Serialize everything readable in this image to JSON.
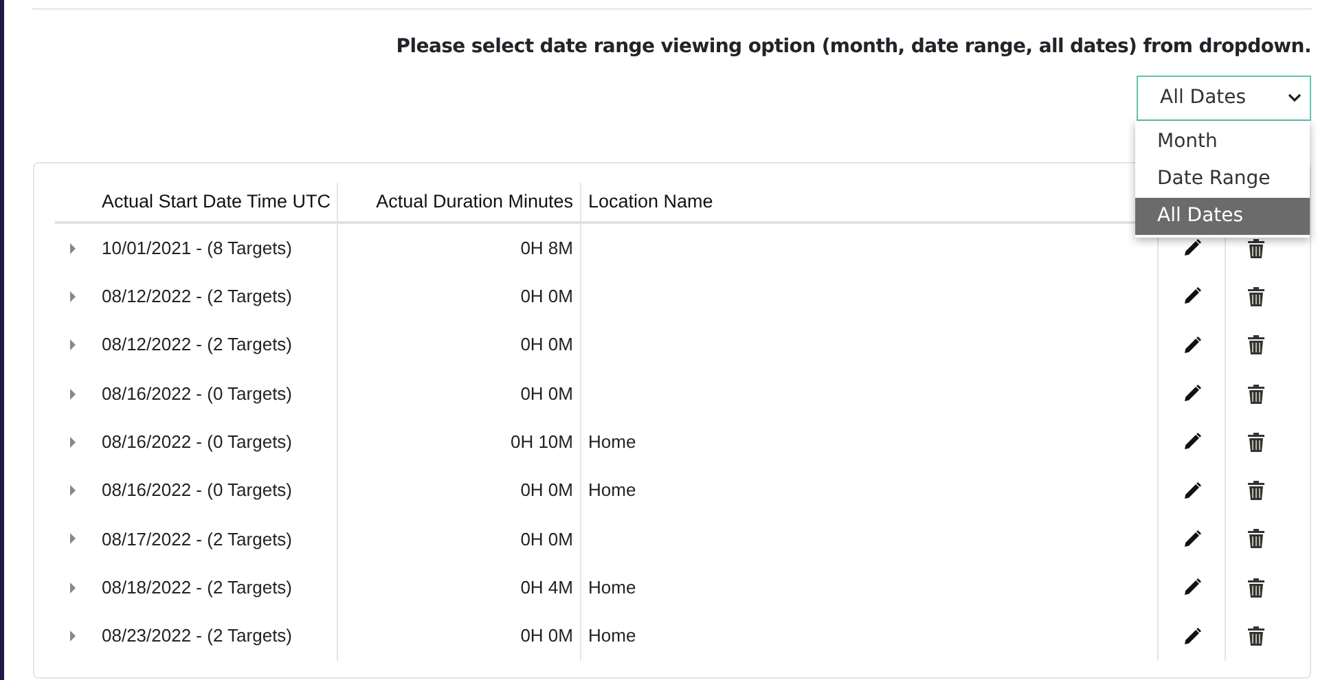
{
  "instruction": "Please select date range viewing option (month, date range, all dates) from dropdown.",
  "date_select": {
    "value": "All Dates",
    "open": true,
    "options": [
      {
        "label": "Month",
        "selected": false
      },
      {
        "label": "Date Range",
        "selected": false
      },
      {
        "label": "All Dates",
        "selected": true
      }
    ]
  },
  "table": {
    "columns": [
      "Actual Start Date Time UTC",
      "Actual Duration Minutes",
      "Location Name"
    ],
    "rows": [
      {
        "start": "10/01/2021 - (8 Targets)",
        "duration": "0H 8M",
        "location": "",
        "expanded": false
      },
      {
        "start": "08/12/2022 - (2 Targets)",
        "duration": "0H 0M",
        "location": "",
        "expanded": false
      },
      {
        "start": "08/12/2022 - (2 Targets)",
        "duration": "0H 0M",
        "location": "",
        "expanded": false
      },
      {
        "start": "08/16/2022 - (0 Targets)",
        "duration": "0H 0M",
        "location": "",
        "expanded": false
      },
      {
        "start": "08/16/2022 - (0 Targets)",
        "duration": "0H 10M",
        "location": "Home",
        "expanded": false
      },
      {
        "start": "08/16/2022 - (0 Targets)",
        "duration": "0H 0M",
        "location": "Home",
        "expanded": false
      },
      {
        "start": "08/17/2022 - (2 Targets)",
        "duration": "0H 0M",
        "location": "",
        "expanded": false
      },
      {
        "start": "08/18/2022 - (2 Targets)",
        "duration": "0H 4M",
        "location": "Home",
        "expanded": false
      },
      {
        "start": "08/23/2022 - (2 Targets)",
        "duration": "0H 0M",
        "location": "Home",
        "expanded": false
      }
    ]
  }
}
